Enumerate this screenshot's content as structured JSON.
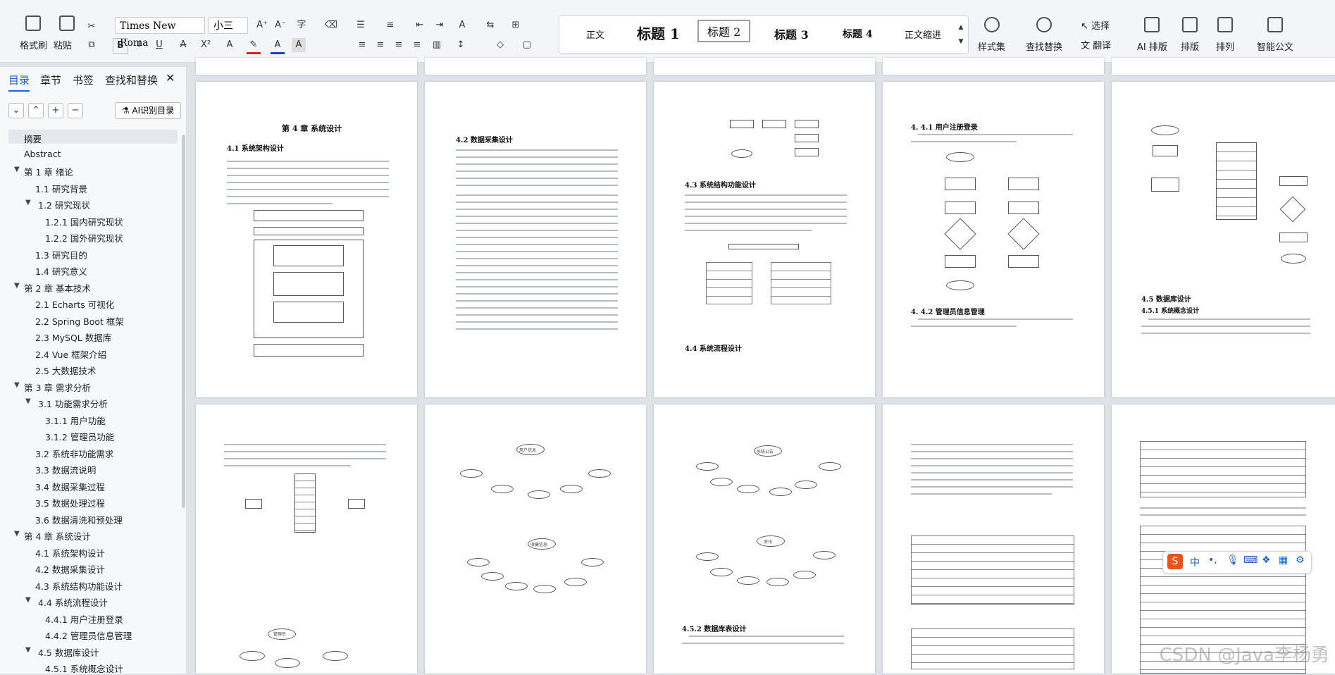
{
  "ribbon": {
    "paste_group": {
      "format_painter": "格式刷",
      "paste": "粘贴"
    },
    "font_name": "Times New Roma",
    "font_size": "小三",
    "styles": [
      "正文",
      "标题 1",
      "标题 2",
      "标题 3",
      "标题 4",
      "正文缩进"
    ],
    "style_set": "样式集",
    "find_replace": "查找替换",
    "select": "选择",
    "translate": "翻译",
    "ai_layout": "AI 排版",
    "layout": "排版",
    "arrange": "排列",
    "smart_doc": "智能公文"
  },
  "nav": {
    "tabs": [
      "目录",
      "章节",
      "书签",
      "查找和替换"
    ],
    "ai_toc": "AI识别目录",
    "toc": [
      {
        "label": "摘要",
        "level": 0,
        "selected": true
      },
      {
        "label": "Abstract",
        "level": 0
      },
      {
        "label": "第 1 章  绪论",
        "level": 0,
        "expand": true
      },
      {
        "label": "1.1 研究背景",
        "level": 1
      },
      {
        "label": "1.2 研究现状",
        "level": 1,
        "expand": true
      },
      {
        "label": "1.2.1 国内研究现状",
        "level": 2
      },
      {
        "label": "1.2.2 国外研究现状",
        "level": 2
      },
      {
        "label": "1.3 研究目的",
        "level": 1
      },
      {
        "label": "1.4 研究意义",
        "level": 1
      },
      {
        "label": "第 2 章  基本技术",
        "level": 0,
        "expand": true
      },
      {
        "label": "2.1 Echarts 可视化",
        "level": 1
      },
      {
        "label": "2.2 Spring Boot 框架",
        "level": 1
      },
      {
        "label": "2.3 MySQL 数据库",
        "level": 1
      },
      {
        "label": "2.4 Vue 框架介绍",
        "level": 1
      },
      {
        "label": "2.5 大数据技术",
        "level": 1
      },
      {
        "label": "第 3 章  需求分析",
        "level": 0,
        "expand": true
      },
      {
        "label": "3.1 功能需求分析",
        "level": 1,
        "expand": true
      },
      {
        "label": "3.1.1 用户功能",
        "level": 2
      },
      {
        "label": "3.1.2 管理员功能",
        "level": 2
      },
      {
        "label": "3.2 系统非功能需求",
        "level": 1
      },
      {
        "label": "3.3 数据流说明",
        "level": 1
      },
      {
        "label": "3.4 数据采集过程",
        "level": 1
      },
      {
        "label": "3.5 数据处理过程",
        "level": 1
      },
      {
        "label": "3.6 数据清洗和预处理",
        "level": 1
      },
      {
        "label": "第 4 章  系统设计",
        "level": 0,
        "expand": true
      },
      {
        "label": "4.1 系统架构设计",
        "level": 1
      },
      {
        "label": "4.2 数据采集设计",
        "level": 1
      },
      {
        "label": "4.3 系统结构功能设计",
        "level": 1
      },
      {
        "label": "4.4 系统流程设计",
        "level": 1,
        "expand": true
      },
      {
        "label": "4.4.1 用户注册登录",
        "level": 2
      },
      {
        "label": "4.4.2 管理员信息管理",
        "level": 2
      },
      {
        "label": "4.5 数据库设计",
        "level": 1,
        "expand": true
      },
      {
        "label": "4.5.1 系统概念设计",
        "level": 2
      }
    ]
  },
  "pages": {
    "p1_title": "第 4 章  系统设计",
    "p1_h1": "4.1  系统架构设计",
    "p2_h1": "4.2  数据采集设计",
    "p2_h2": "4.3  系统结构功能设计",
    "p2_h3": "4.4  系统流程设计",
    "p4_h1": "4. 4.1  用户注册登录",
    "p4_h2": "4. 4.2  管理员信息管理",
    "p5_h1": "4.5  数据库设计",
    "p5_h2": "4.5.1  系统概念设计",
    "p8_h1": "4.5.2  数据库表设计",
    "node_user": "用户信息",
    "node_admin": "管理员",
    "node_sys": "系统公告",
    "node_news": "资讯",
    "node_fav": "收藏信息"
  },
  "ime": {
    "label": "中"
  },
  "watermark": "CSDN @Java李杨勇"
}
